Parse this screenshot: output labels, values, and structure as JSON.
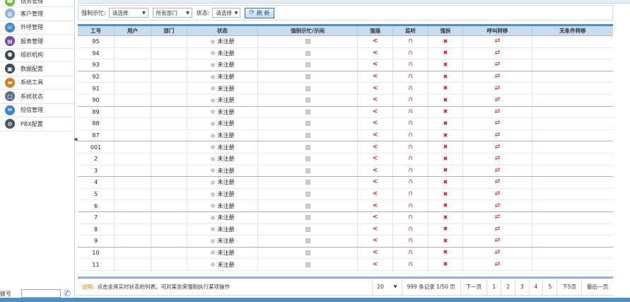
{
  "sidebar": {
    "items": [
      {
        "label": "话务管理",
        "icon": "phone-icon",
        "color": "#6cbf3a"
      },
      {
        "label": "客户管理",
        "icon": "globe-icon",
        "color": "#8fb5d6"
      },
      {
        "label": "外呼管理",
        "icon": "outbound-call-icon",
        "color": "#3f86c7"
      },
      {
        "label": "报表管理",
        "icon": "report-book-icon",
        "color": "#6b4aa3"
      },
      {
        "label": "组织机构",
        "icon": "organization-icon",
        "color": "#3c4a57"
      },
      {
        "label": "数据配置",
        "icon": "database-icon",
        "color": "#3c4a57"
      },
      {
        "label": "系统工具",
        "icon": "toolbox-icon",
        "color": "#e07b1a"
      },
      {
        "label": "系统状态",
        "icon": "monitor-icon",
        "color": "#5a6f86"
      },
      {
        "label": "短信管理",
        "icon": "message-icon",
        "color": "#3a86d1"
      },
      {
        "label": "PBX配置",
        "icon": "gear-icon",
        "color": "#4a5560"
      }
    ],
    "dial_label": "拨号",
    "dial_value": ""
  },
  "filters": {
    "forced_busy_label": "强制示忙:",
    "forced_busy_value": "请选择",
    "dept_value": "所有部门",
    "status_label": "状态:",
    "status_value": "请选择",
    "refresh_label": "刷 新"
  },
  "table": {
    "headers": [
      "工号",
      "用户",
      "部门",
      "状态",
      "强制示忙/示闲",
      "强插",
      "监听",
      "强拆",
      "呼叫转移",
      "无条件转移"
    ],
    "rows": [
      {
        "id": "95",
        "user": "",
        "dept": "",
        "status": "未注册",
        "sep": false
      },
      {
        "id": "94",
        "user": "",
        "dept": "",
        "status": "未注册",
        "sep": false
      },
      {
        "id": "93",
        "user": "",
        "dept": "",
        "status": "未注册",
        "sep": true
      },
      {
        "id": "92",
        "user": "",
        "dept": "",
        "status": "未注册",
        "sep": false
      },
      {
        "id": "91",
        "user": "",
        "dept": "",
        "status": "未注册",
        "sep": false
      },
      {
        "id": "90",
        "user": "",
        "dept": "",
        "status": "未注册",
        "sep": true
      },
      {
        "id": "89",
        "user": "",
        "dept": "",
        "status": "未注册",
        "sep": false
      },
      {
        "id": "88",
        "user": "",
        "dept": "",
        "status": "未注册",
        "sep": false
      },
      {
        "id": "87",
        "user": "",
        "dept": "",
        "status": "未注册",
        "sep": true
      },
      {
        "id": "001",
        "user": "",
        "dept": "",
        "status": "未注册",
        "sep": false
      },
      {
        "id": "2",
        "user": "",
        "dept": "",
        "status": "未注册",
        "sep": false
      },
      {
        "id": "3",
        "user": "",
        "dept": "",
        "status": "未注册",
        "sep": true
      },
      {
        "id": "4",
        "user": "",
        "dept": "",
        "status": "未注册",
        "sep": false
      },
      {
        "id": "5",
        "user": "",
        "dept": "",
        "status": "未注册",
        "sep": false
      },
      {
        "id": "6",
        "user": "",
        "dept": "",
        "status": "未注册",
        "sep": true
      },
      {
        "id": "7",
        "user": "",
        "dept": "",
        "status": "未注册",
        "sep": false
      },
      {
        "id": "8",
        "user": "",
        "dept": "",
        "status": "未注册",
        "sep": false
      },
      {
        "id": "9",
        "user": "",
        "dept": "",
        "status": "未注册",
        "sep": true
      },
      {
        "id": "10",
        "user": "",
        "dept": "",
        "status": "未注册",
        "sep": false
      },
      {
        "id": "11",
        "user": "",
        "dept": "",
        "status": "未注册",
        "sep": false
      }
    ],
    "action_color": "#d8191f"
  },
  "footer": {
    "hint_label": "说明:",
    "hint_text": "点击坐席实时状态的列表。可对某坐席强制执行某项操作",
    "page_size": "20",
    "record_info": "999 条记录 1/50 页",
    "prev": "下一页",
    "pages": [
      "1",
      "2",
      "3",
      "4",
      "5"
    ],
    "next": "下5页",
    "last": "最后一页"
  }
}
